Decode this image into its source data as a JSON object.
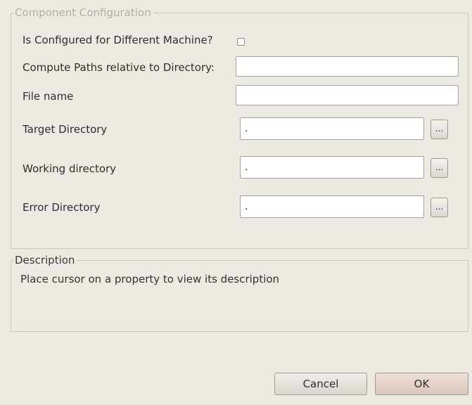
{
  "config": {
    "legend": "Component Configuration",
    "different_machine_label": "Is Configured for Different Machine?",
    "different_machine_checked": false,
    "compute_paths_label": "Compute Paths relative to Directory:",
    "compute_paths_value": "",
    "file_name_label": "File name",
    "file_name_value": "",
    "target_dir_label": "Target Directory",
    "target_dir_value": ".",
    "working_dir_label": "Working directory",
    "working_dir_value": ".",
    "error_dir_label": "Error Directory",
    "error_dir_value": ".",
    "browse_label": "..."
  },
  "description": {
    "legend": "Description",
    "text": "Place cursor on a property to view its description"
  },
  "buttons": {
    "cancel": "Cancel",
    "ok": "OK"
  }
}
